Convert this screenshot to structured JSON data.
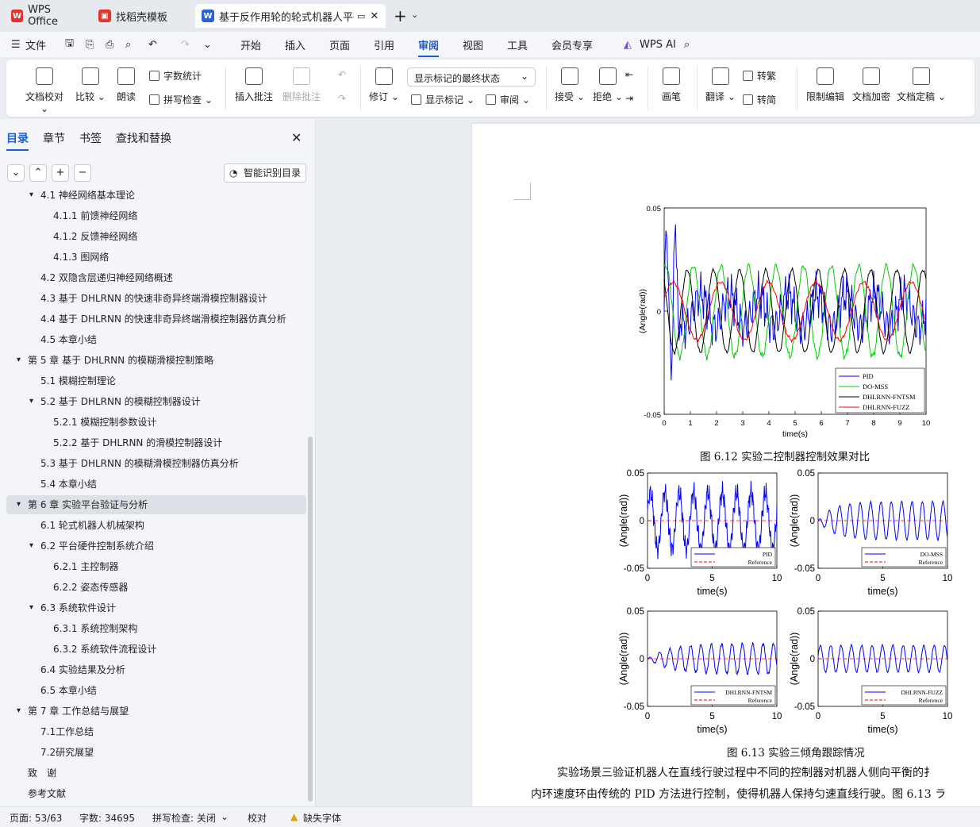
{
  "tabs": [
    {
      "label": "WPS Office"
    },
    {
      "label": "找稻壳模板"
    },
    {
      "label": "基于反作用轮的轮式机器人平衡"
    }
  ],
  "menu": {
    "file": "文件",
    "items": [
      "开始",
      "插入",
      "页面",
      "引用",
      "审阅",
      "视图",
      "工具",
      "会员专享"
    ],
    "active": "审阅",
    "ai": "WPS AI"
  },
  "ribbon": {
    "proofread": "文档校对",
    "compare": "比较",
    "read": "朗读",
    "wordcount": "字数统计",
    "spellcheck": "拼写检查",
    "insert_comment": "插入批注",
    "delete_comment": "删除批注",
    "revise": "修订",
    "show_state": "显示标记的最终状态",
    "show_marks": "显示标记",
    "review": "审阅",
    "accept": "接受",
    "reject": "拒绝",
    "pen": "画笔",
    "translate": "翻译",
    "to_trad": "转繁",
    "to_simp": "转简",
    "restrict": "限制编辑",
    "encrypt": "文档加密",
    "finalize": "文档定稿"
  },
  "sidebar": {
    "tabs": [
      "目录",
      "章节",
      "书签",
      "查找和替换"
    ],
    "smart": "智能识别目录",
    "toc": [
      {
        "label": "4.1 神经网络基本理论",
        "level": 1,
        "arrow": "▾"
      },
      {
        "label": "4.1.1 前馈神经网络",
        "level": 2
      },
      {
        "label": "4.1.2 反馈神经网络",
        "level": 2
      },
      {
        "label": "4.1.3 图网络",
        "level": 2
      },
      {
        "label": "4.2 双隐含层递归神经网络概述",
        "level": 1
      },
      {
        "label": "4.3 基于 DHLRNN 的快速非奇异终端滑模控制器设计",
        "level": 1
      },
      {
        "label": "4.4 基于 DHLRNN 的快速非奇异终端滑模控制器仿真分析",
        "level": 1
      },
      {
        "label": "4.5 本章小结",
        "level": 1
      },
      {
        "label": "第 5 章 基于 DHLRNN 的模糊滑模控制策略",
        "level": 0,
        "arrow": "▾"
      },
      {
        "label": "5.1 模糊控制理论",
        "level": 1
      },
      {
        "label": "5.2 基于 DHLRNN 的模糊控制器设计",
        "level": 1,
        "arrow": "▾"
      },
      {
        "label": "5.2.1 模糊控制参数设计",
        "level": 2
      },
      {
        "label": "5.2.2 基于 DHLRNN 的滑模控制器设计",
        "level": 2
      },
      {
        "label": "5.3 基于 DHLRNN 的模糊滑模控制器仿真分析",
        "level": 1
      },
      {
        "label": "5.4 本章小结",
        "level": 1
      },
      {
        "label": "第 6 章 实验平台验证与分析",
        "level": 0,
        "arrow": "▾",
        "selected": true
      },
      {
        "label": "6.1 轮式机器人机械架构",
        "level": 1
      },
      {
        "label": "6.2 平台硬件控制系统介绍",
        "level": 1,
        "arrow": "▾"
      },
      {
        "label": "6.2.1 主控制器",
        "level": 2
      },
      {
        "label": "6.2.2 姿态传感器",
        "level": 2
      },
      {
        "label": "6.3 系统软件设计",
        "level": 1,
        "arrow": "▾"
      },
      {
        "label": "6.3.1 系统控制架构",
        "level": 2
      },
      {
        "label": "6.3.2 系统软件流程设计",
        "level": 2
      },
      {
        "label": "6.4 实验结果及分析",
        "level": 1
      },
      {
        "label": "6.5 本章小结",
        "level": 1
      },
      {
        "label": "第 7 章 工作总结与展望",
        "level": 0,
        "arrow": "▾"
      },
      {
        "label": "7.1工作总结",
        "level": 1
      },
      {
        "label": "7.2研究展望",
        "level": 1
      },
      {
        "label": "致　谢",
        "level": 0
      },
      {
        "label": "参考文献",
        "level": 0
      }
    ]
  },
  "document": {
    "caption1": "图 6.12 实验二控制器控制效果对比",
    "caption2": "图 6.13 实验三倾角跟踪情况",
    "para1": "实验场景三验证机器人在直线行驶过程中不同的控制器对机器人侧向平衡的扌",
    "para2": "内环速度环由传统的 PID 方法进行控制，使得机器人保持匀速直线行驶。图 6.13 ラ"
  },
  "chart_data": [
    {
      "type": "line",
      "xlabel": "time(s)",
      "ylabel": "(Angle(rad))",
      "xlim": [
        0,
        10
      ],
      "ylim": [
        -0.05,
        0.05
      ],
      "xticks": [
        "0",
        "1",
        "2",
        "3",
        "4",
        "5",
        "6",
        "7",
        "8",
        "9",
        "10"
      ],
      "yticks": [
        "-0.05",
        "0",
        "0.05"
      ],
      "legend_position": "bottom-right",
      "series": [
        {
          "name": "PID",
          "color": "#0000ff"
        },
        {
          "name": "DO-MSS",
          "color": "#00cc00"
        },
        {
          "name": "DHLRNN-FNTSM",
          "color": "#000000"
        },
        {
          "name": "DHLRNN-FUZZ",
          "color": "#ff0000"
        }
      ]
    },
    {
      "type": "line",
      "xlabel": "time(s)",
      "ylabel": "(Angle(rad))",
      "xlim": [
        0,
        10
      ],
      "ylim": [
        -0.05,
        0.05
      ],
      "xticks": [
        "0",
        "5",
        "10"
      ],
      "yticks": [
        "-0.05",
        "0",
        "0.05"
      ],
      "series": [
        {
          "name": "PID",
          "color": "#0000ff"
        },
        {
          "name": "Reference",
          "color": "#ff0000"
        }
      ]
    },
    {
      "type": "line",
      "xlabel": "time(s)",
      "ylabel": "(Angle(rad))",
      "xlim": [
        0,
        10
      ],
      "ylim": [
        -0.05,
        0.05
      ],
      "xticks": [
        "0",
        "5",
        "10"
      ],
      "yticks": [
        "-0.05",
        "0",
        "0.05"
      ],
      "series": [
        {
          "name": "DO-MSS",
          "color": "#0000ff"
        },
        {
          "name": "Reference",
          "color": "#ff0000"
        }
      ]
    },
    {
      "type": "line",
      "xlabel": "time(s)",
      "ylabel": "(Angle(rad))",
      "xlim": [
        0,
        10
      ],
      "ylim": [
        -0.05,
        0.05
      ],
      "xticks": [
        "0",
        "5",
        "10"
      ],
      "yticks": [
        "-0.05",
        "0",
        "0.05"
      ],
      "series": [
        {
          "name": "DHLRNN-FNTSM",
          "color": "#0000ff"
        },
        {
          "name": "Reference",
          "color": "#ff0000"
        }
      ]
    },
    {
      "type": "line",
      "xlabel": "time(s)",
      "ylabel": "(Angle(rad))",
      "xlim": [
        0,
        10
      ],
      "ylim": [
        -0.05,
        0.05
      ],
      "xticks": [
        "0",
        "5",
        "10"
      ],
      "yticks": [
        "-0.05",
        "0",
        "0.05"
      ],
      "series": [
        {
          "name": "DHLRNN-FUZZ",
          "color": "#0000ff"
        },
        {
          "name": "Reference",
          "color": "#ff0000"
        }
      ]
    }
  ],
  "status": {
    "page": "页面: 53/63",
    "words": "字数: 34695",
    "spell": "拼写检查: 关闭",
    "proof": "校对",
    "font": "缺失字体"
  }
}
